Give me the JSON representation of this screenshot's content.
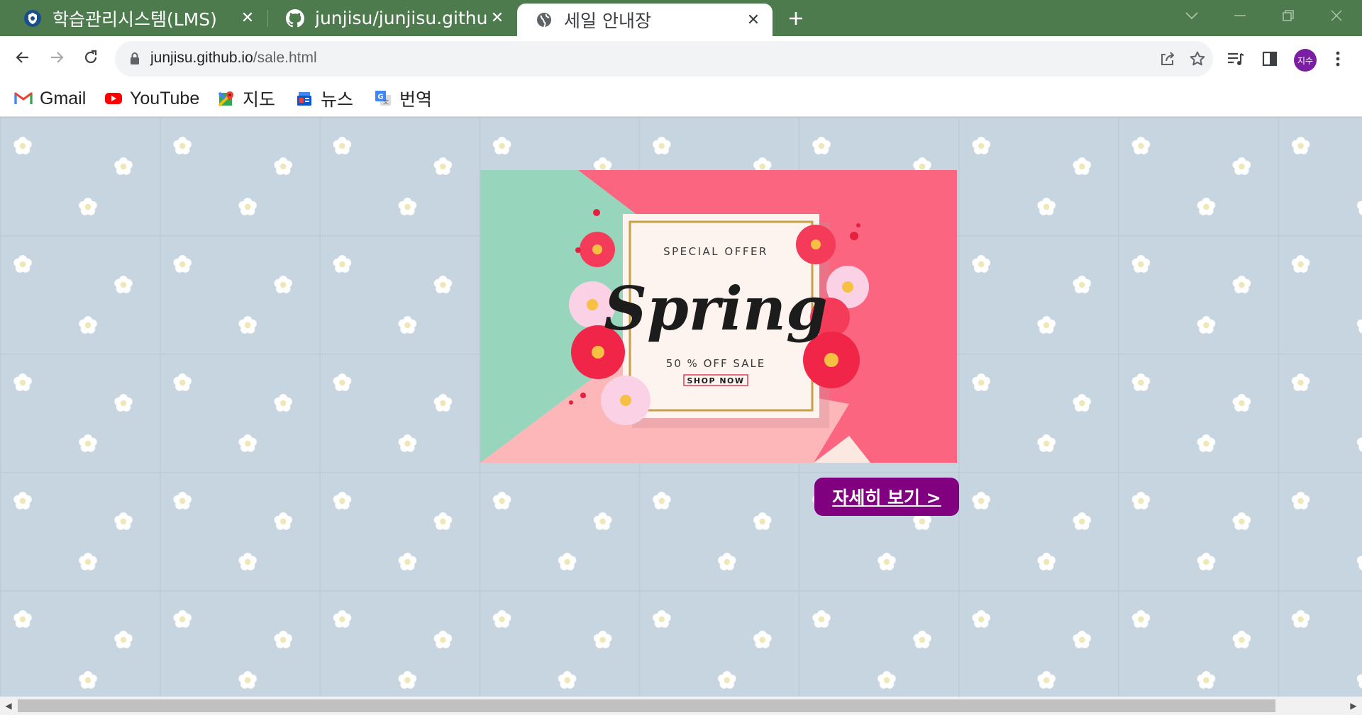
{
  "tabs": [
    {
      "title": "학습관리시스템(LMS)",
      "favicon": "lms-shield-icon",
      "close": "✕"
    },
    {
      "title": "junjisu/junjisu.github.io",
      "favicon": "github-icon",
      "close": "✕"
    },
    {
      "title": "세일 안내장",
      "favicon": "globe-icon",
      "close": "✕"
    }
  ],
  "address_bar": {
    "domain": "junjisu.github.io",
    "path": "/sale.html"
  },
  "profile": {
    "initials": "지수",
    "color": "#7b1fa2"
  },
  "bookmarks": [
    {
      "label": "Gmail",
      "icon": "gmail-icon"
    },
    {
      "label": "YouTube",
      "icon": "youtube-icon"
    },
    {
      "label": "지도",
      "icon": "maps-icon"
    },
    {
      "label": "뉴스",
      "icon": "news-icon"
    },
    {
      "label": "번역",
      "icon": "translate-icon"
    }
  ],
  "banner": {
    "special_offer": "SPECIAL OFFER",
    "headline": "Spring",
    "discount": "50 % OFF SALE",
    "shop_now": "SHOP NOW"
  },
  "more_button": {
    "label": "자세히 보기 >",
    "color": "#800080"
  },
  "colors": {
    "tabstrip": "#4e7b4e",
    "page_background": "#c7d5e0",
    "banner_pink": "#fb6580",
    "banner_mint": "#97d6bd",
    "banner_light_pink": "#fdb7b9"
  }
}
